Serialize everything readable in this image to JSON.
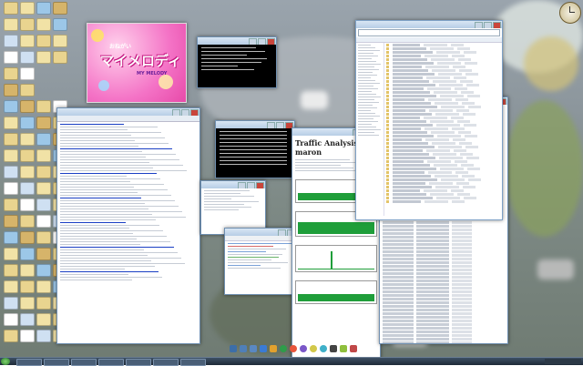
{
  "melody_window": {
    "title_large": "マイメロディ",
    "title_small": "おねがい",
    "subtitle": "MY MELODY"
  },
  "traffic_window": {
    "heading": "Traffic Analysis — maron"
  },
  "colors": {
    "graph_green": "#1f9e3a",
    "link_blue": "#1a3fc4",
    "titlebar": "#c9dbee",
    "terminal_bg": "#000000"
  },
  "icons": [
    "folder-icon",
    "document-icon",
    "clock-icon",
    "browser-icon",
    "terminal-icon",
    "music-icon",
    "app-icon",
    "recycle-bin-icon"
  ]
}
